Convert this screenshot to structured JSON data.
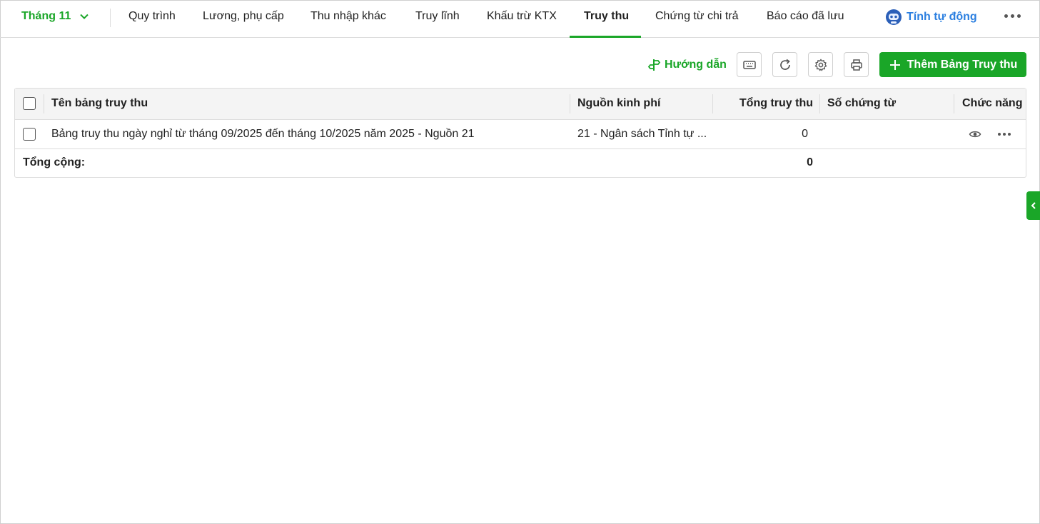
{
  "nav": {
    "month": "Tháng 11",
    "tabs": [
      {
        "label": "Quy trình"
      },
      {
        "label": "Lương, phụ cấp"
      },
      {
        "label": "Thu nhập khác"
      },
      {
        "label": "Truy lĩnh"
      },
      {
        "label": "Khấu trừ KTX"
      },
      {
        "label": "Truy thu"
      },
      {
        "label": "Chứng từ chi trả"
      },
      {
        "label": "Báo cáo đã lưu"
      }
    ],
    "active_tab": "Truy thu",
    "auto_label": "Tính tự động"
  },
  "toolbar": {
    "guide_label": "Hướng dẫn",
    "add_label": "Thêm Bảng Truy thu"
  },
  "table": {
    "columns": [
      "Tên bảng truy thu",
      "Nguồn kinh phí",
      "Tổng truy thu",
      "Số chứng từ",
      "Chức năng"
    ],
    "rows": [
      {
        "name": "Bảng truy thu ngày nghỉ từ tháng 09/2025 đến tháng 10/2025 năm 2025 - Nguồn 21",
        "source": "21 - Ngân sách Tỉnh tự ...",
        "total": "0",
        "voucher": ""
      }
    ],
    "total_label": "Tổng cộng:",
    "total_value": "0"
  },
  "colors": {
    "accent": "#1aa628",
    "link_blue": "#2b7fe0"
  }
}
